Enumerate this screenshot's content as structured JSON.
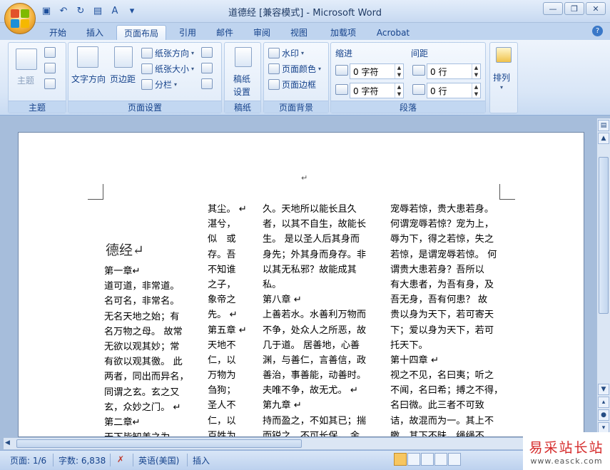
{
  "title": "道德经 [兼容模式] - Microsoft Word",
  "quick_access": [
    "save-icon",
    "undo-icon",
    "redo-icon",
    "print-preview-icon",
    "spelling-icon",
    "customize-icon"
  ],
  "tabs": [
    "开始",
    "插入",
    "页面布局",
    "引用",
    "邮件",
    "审阅",
    "视图",
    "加载项",
    "Acrobat"
  ],
  "active_tab": "页面布局",
  "ribbon": {
    "themes": {
      "label": "主题",
      "theme_button": "主题"
    },
    "page_setup": {
      "label": "页面设置",
      "text_direction": "文字方向",
      "margins": "页边距",
      "orientation": "纸张方向",
      "size": "纸张大小",
      "columns": "分栏"
    },
    "manuscript": {
      "label": "稿纸",
      "button": "稿纸\n设置",
      "button_line1": "稿纸",
      "button_line2": "设置"
    },
    "page_background": {
      "label": "页面背景",
      "watermark": "水印",
      "page_color": "页面颜色",
      "page_borders": "页面边框"
    },
    "paragraph": {
      "label": "段落",
      "indent_label": "缩进",
      "spacing_label": "间距",
      "indent_left": "0 字符",
      "indent_right": "0 字符",
      "spacing_before": "0 行",
      "spacing_after": "0 行"
    },
    "arrange": {
      "label": "排列"
    }
  },
  "document": {
    "top_mark": "↵",
    "heading": "德经↵",
    "columns": [
      [
        "第一章↵",
        "道可道，非常道。",
        "名可名，非常名。",
        "无名天地之始；有",
        "名万物之母。 故常",
        "无欲以观其妙；常",
        "有欲以观其徼。 此",
        "两者，同出而异名，",
        "同谓之玄。玄之又",
        "玄，众妙之门。 ↵",
        "第二章↵",
        "天下皆知美之为"
      ],
      [
        "其尘。 ↵",
        "湛兮，",
        "似　或",
        "存。吾",
        "不知谁",
        "之子，",
        "象帝之",
        "先。 ↵",
        "第五章 ↵",
        "天地不",
        "仁，以",
        "万物为",
        "刍狗；",
        "圣人不",
        "仁，以",
        "百姓为"
      ],
      [
        "久。天地所以能长且久",
        "者，以其不自生，故能长",
        "生。 是以圣人后其身而",
        "身先；外其身而身存。非",
        "以其无私邪？故能成其",
        "私。",
        "第八章 ↵",
        "上善若水。水善利万物而",
        "不争，处众人之所恶，故",
        "几于道。 居善地，心善",
        "渊，与善仁，言善信，政",
        "善治，事善能，动善时。",
        "夫唯不争，故无尤。 ↵",
        "第九章 ↵",
        "持而盈之，不如其已；揣",
        "而锐之，不可长保。 金"
      ],
      [
        "宠辱若惊，贵大患若身。",
        "何谓宠辱若惊？宠为上，",
        "辱为下，得之若惊，失之",
        "若惊，是谓宠辱若惊。 何",
        "谓贵大患若身？吾所以",
        "有大患者，为吾有身，及",
        "吾无身，吾有何患？ 故",
        "贵以身为天下，若可寄天",
        "下；爱以身为天下，若可",
        "托天下。",
        "第十四章 ↵",
        "视之不见，名曰夷；听之",
        "不闻，名曰希；搏之不得，",
        "名曰微。此三者不可致",
        "诘，故混而为一。其上不",
        "皦，其下不昧。绳绳不"
      ]
    ]
  },
  "status": {
    "page": "页面: 1/6",
    "words": "字数: 6,838",
    "language": "英语(美国)",
    "mode": "插入"
  },
  "watermark": {
    "line1": "易采站长站",
    "line2": "www.easck.com"
  },
  "colors": {
    "accent": "#15428b",
    "ribbon": "#dfeaf8",
    "workspace": "#a6bddb"
  }
}
